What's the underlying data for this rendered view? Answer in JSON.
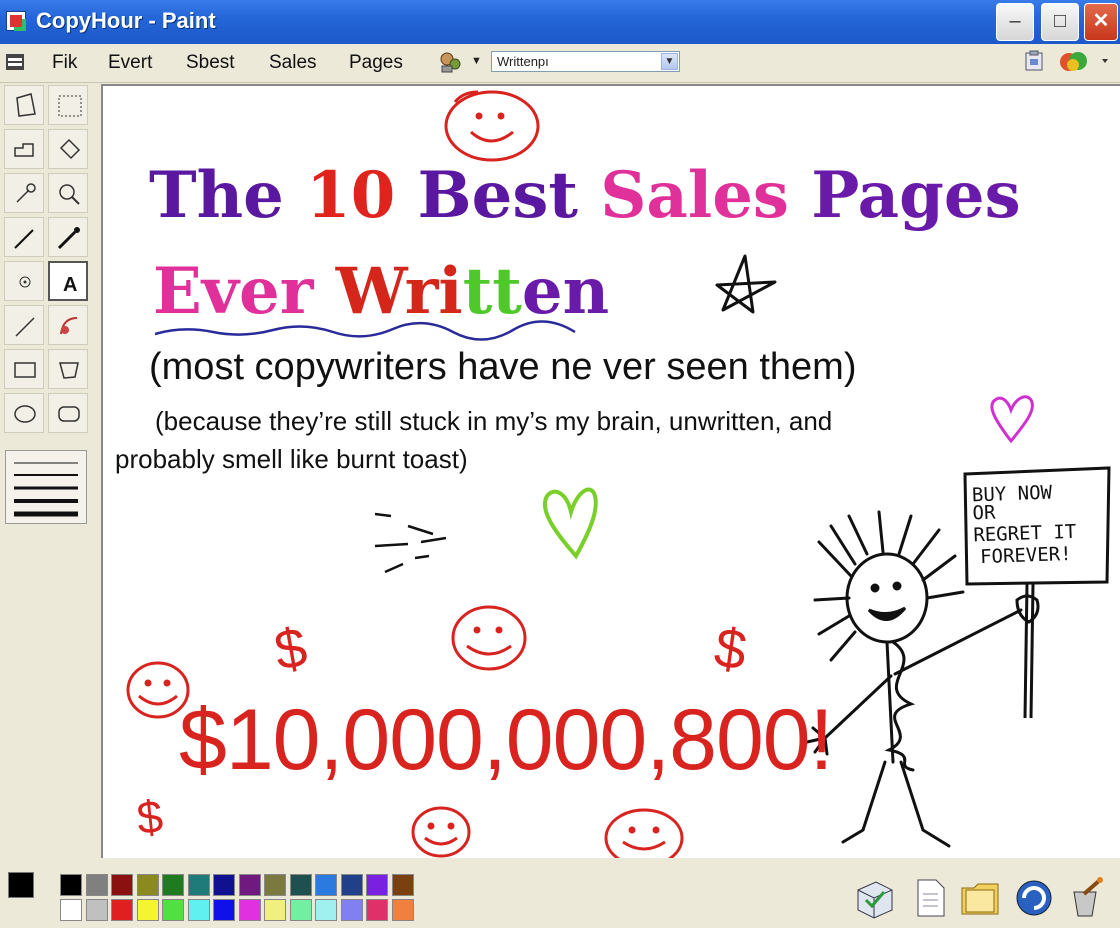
{
  "window": {
    "title": "CopyHour - Paint",
    "minimize_label": "–",
    "maximize_label": "□",
    "close_label": "✕"
  },
  "menu": [
    "Fik",
    "Evert",
    "Sbest",
    "Sales",
    "Pages"
  ],
  "font_combo": {
    "value": "Writtenpı"
  },
  "canvas": {
    "headline": {
      "line1": [
        {
          "text": "The ",
          "color": "#5a18a0"
        },
        {
          "text": "10 ",
          "color": "#e0231c"
        },
        {
          "text": "Best ",
          "color": "#5a18a0"
        },
        {
          "text": "Sales ",
          "color": "#e0309a"
        },
        {
          "text": "Pages",
          "color": "#6a1aa8"
        }
      ],
      "line2": [
        {
          "text": "Ever ",
          "color": "#e0309a"
        },
        {
          "text": "Wri",
          "color": "#d4261a"
        },
        {
          "text": "tt",
          "color": "#4fc92a"
        },
        {
          "text": "en",
          "color": "#6a1aa8"
        }
      ]
    },
    "subtitle": "(most copywriters have ne  ver seen them)",
    "note_line1": "(because they’re still stuck in my’s my brain, unwritten, and",
    "note_line2": "probably smell like burnt toast)",
    "sign_text": [
      "BUY NOW",
      "OR",
      "REGRET IT",
      "FOREVER!"
    ],
    "big_amount": "$10,000,000,800!",
    "dollar_sign": "$"
  },
  "palette": {
    "foreground": "#000000",
    "background": "#ffffff",
    "colors_row1": [
      "#000000",
      "#808080",
      "#8b1010",
      "#8a8a20",
      "#1f7a20",
      "#1f7a7a",
      "#101090",
      "#701a80",
      "#7a7a40",
      "#1f5050",
      "#2a7ae0",
      "#20408a",
      "#7a20e0",
      "#7a4010"
    ],
    "colors_row2": [
      "#ffffff",
      "#c0c0c0",
      "#e02020",
      "#f4f430",
      "#50e040",
      "#60f0f0",
      "#1010e8",
      "#e030e0",
      "#f0f080",
      "#70f0a0",
      "#a0f0f0",
      "#8080f0",
      "#e0306a",
      "#f08040"
    ]
  },
  "accent_colors": {
    "titlebar": "#2466d8",
    "money_red": "#d8231f",
    "heart_green": "#7ad02a",
    "heart_magenta": "#d030d0"
  }
}
